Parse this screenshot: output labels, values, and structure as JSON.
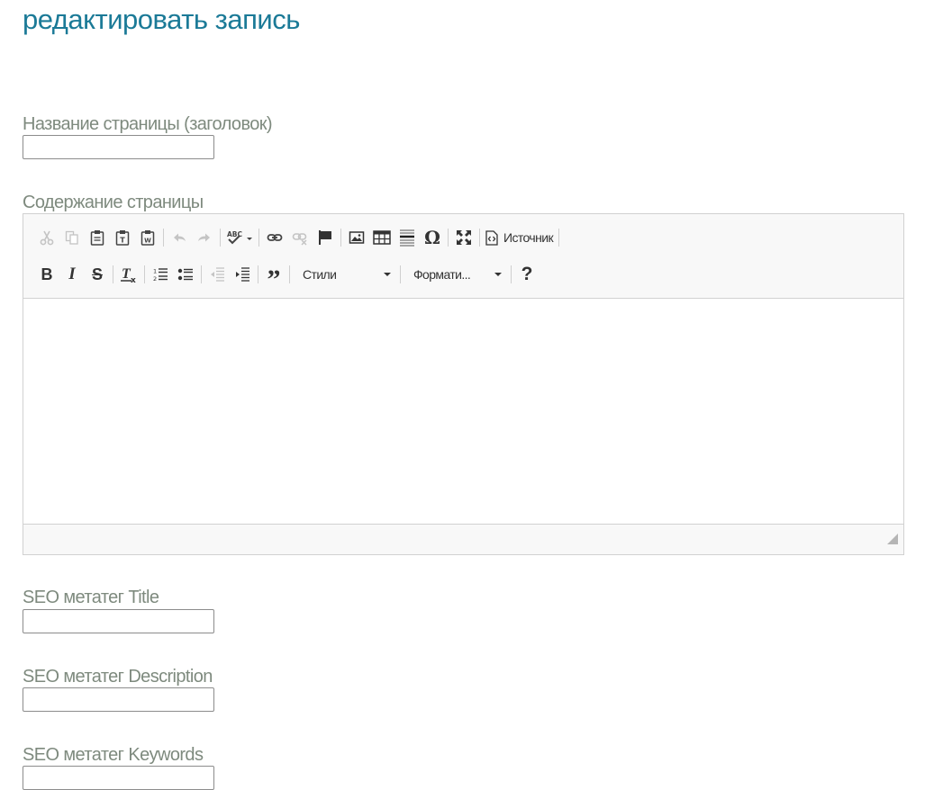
{
  "page": {
    "title": "редактировать запись"
  },
  "fields": {
    "title": {
      "label": "Название страницы (заголовок)",
      "value": ""
    },
    "content": {
      "label": "Содержание страницы",
      "value": ""
    },
    "seo_title": {
      "label": "SEO метатег Title",
      "value": ""
    },
    "seo_description": {
      "label": "SEO метатег Description",
      "value": ""
    },
    "seo_keywords": {
      "label": "SEO метатег Keywords",
      "value": ""
    }
  },
  "editor": {
    "toolbar_row1": {
      "icons": [
        "cut-icon",
        "copy-icon",
        "paste-icon",
        "paste-text-icon",
        "paste-word-icon",
        "undo-icon",
        "redo-icon",
        "spellcheck-icon",
        "link-icon",
        "unlink-icon",
        "anchor-icon",
        "image-icon",
        "table-icon",
        "horizontal-rule-icon",
        "special-char-icon",
        "maximize-icon",
        "source-icon"
      ],
      "source_label": "Источник"
    },
    "toolbar_row2": {
      "icons": [
        "bold-icon",
        "italic-icon",
        "strike-icon",
        "remove-format-icon",
        "numbered-list-icon",
        "bulleted-list-icon",
        "outdent-icon",
        "indent-icon",
        "blockquote-icon",
        "help-icon"
      ],
      "styles_label": "Стили",
      "format_label": "Формати..."
    }
  },
  "colors": {
    "title": "#1b7a97",
    "label": "#7e8a7e",
    "toolbar_bg": "#f8f8f8",
    "border": "#d1d1d1"
  }
}
